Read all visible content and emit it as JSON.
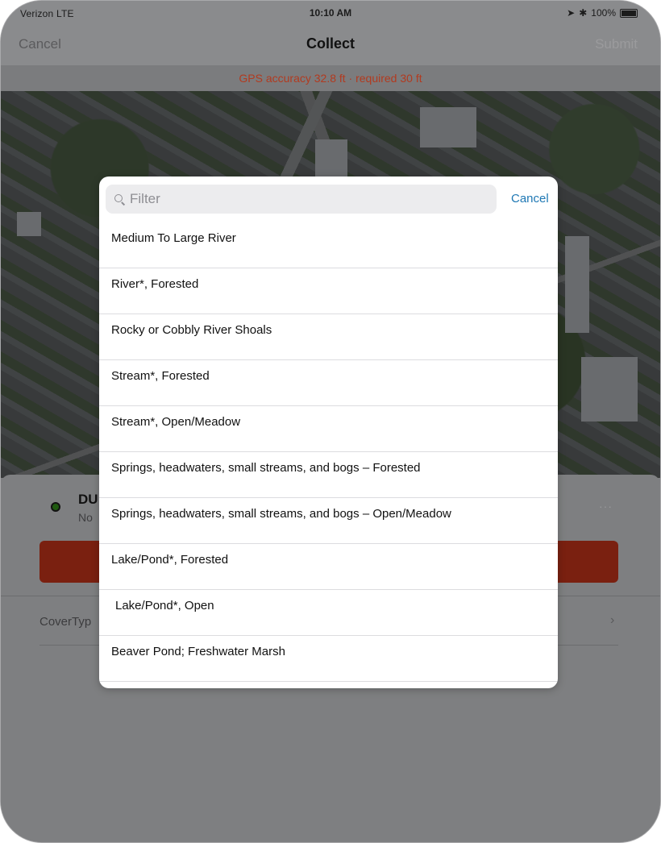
{
  "status_bar": {
    "carrier": "Verizon  LTE",
    "time": "10:10 AM",
    "battery": "100%"
  },
  "nav": {
    "cancel_label": "Cancel",
    "title": "Collect",
    "submit_label": "Submit"
  },
  "gps_banner": "GPS accuracy 32.8 ft · required 30 ft",
  "sheet": {
    "feature_name": "DU",
    "feature_sub": "No",
    "more_label": "···",
    "field_label": "CoverTyp",
    "chevron": "›"
  },
  "picker": {
    "filter_placeholder": "Filter",
    "filter_value": "",
    "cancel_label": "Cancel",
    "items": [
      "Medium To Large River",
      "River*, Forested",
      "Rocky or Cobbly River Shoals",
      "Stream*, Forested",
      "Stream*, Open/Meadow",
      "Springs, headwaters, small streams, and bogs – Forested",
      "Springs, headwaters, small streams, and bogs – Open/Meadow",
      "Lake/Pond*, Forested",
      "Lake/Pond*, Open",
      "Beaver Pond; Freshwater Marsh"
    ]
  },
  "colors": {
    "accent": "#1f78b4",
    "warning": "#b23a1f",
    "action_red": "#7a2010"
  },
  "icons": {
    "location": "location-arrow-icon",
    "bluetooth": "bluetooth-icon",
    "battery": "battery-icon",
    "search": "search-icon"
  }
}
